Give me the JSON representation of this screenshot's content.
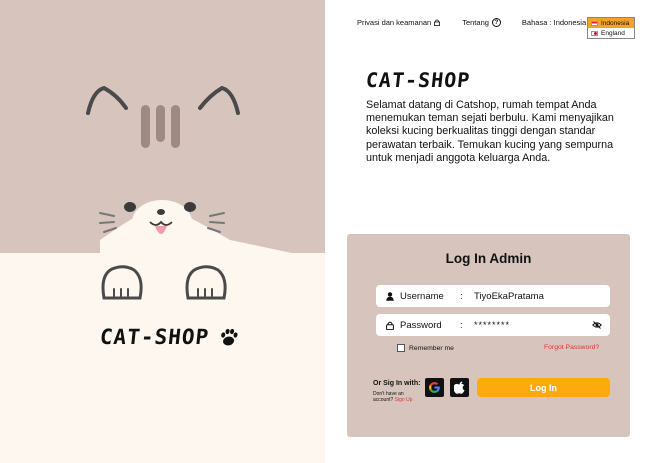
{
  "nav": {
    "privacy_label": "Privasi dan keamanan",
    "about_label": "Tentang",
    "help_glyph": "?",
    "language_label": "Bahasa : Indonesia",
    "language_arrow": "▸",
    "language_options": [
      "Indonesia",
      "England"
    ],
    "selected_language": "Indonesia"
  },
  "brand": {
    "name": "CAT-SHOP"
  },
  "intro": {
    "title": "CAT-SHOP",
    "description": "Selamat datang di Catshop, rumah tempat Anda menemukan teman sejati berbulu. Kami menyajikan koleksi kucing berkualitas tinggi dengan standar perawatan terbaik. Temukan kucing yang sempurna untuk menjadi anggota keluarga Anda."
  },
  "login": {
    "title": "Log In Admin",
    "username_label": "Username",
    "username_value": "TiyoEkaPratama",
    "password_label": "Password",
    "password_value": "********",
    "separator": ":",
    "remember_label": "Remember me",
    "forgot_label": "Forgot Password?",
    "signin_with_label": "Or Sig In with:",
    "no_account_text": "Don't have an account?",
    "signup_label": "Sign Up",
    "login_button": "Log In"
  },
  "icons": {
    "lock": "lock-icon",
    "help": "help-circle-icon",
    "user": "user-icon",
    "eye": "eye-off-icon",
    "google": "google-icon",
    "apple": "apple-icon",
    "paw": "paw-icon"
  },
  "colors": {
    "panel_mauve": "#d7c5bd",
    "cream": "#fdf7f0",
    "accent_orange": "#fdab0c",
    "link_red": "#e33232"
  }
}
